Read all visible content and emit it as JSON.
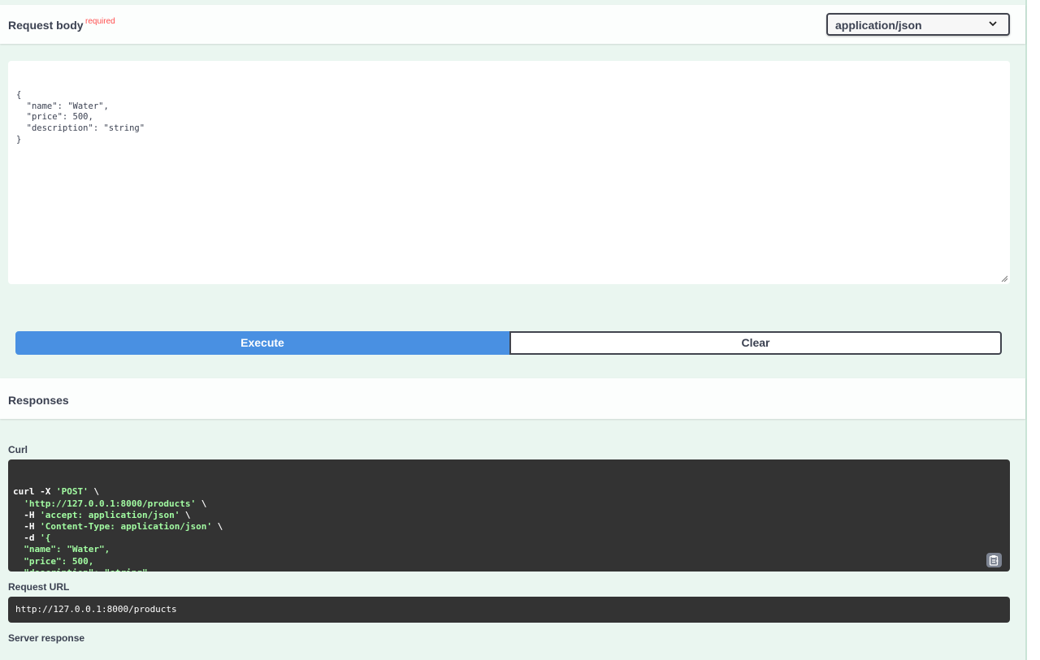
{
  "request_body": {
    "title": "Request body",
    "required_flag": "required",
    "content_type": "application/json",
    "editor_lines": [
      "{",
      "  \"name\": \"Water\",",
      "  \"price\": 500,",
      "  \"description\": \"string\"",
      "}"
    ]
  },
  "actions": {
    "execute_label": "Execute",
    "clear_label": "Clear"
  },
  "responses": {
    "title": "Responses",
    "curl_label": "Curl",
    "curl_lines": [
      [
        {
          "t": "curl -X ",
          "c": "white"
        },
        {
          "t": "'POST'",
          "c": "green"
        },
        {
          "t": " \\",
          "c": "white"
        }
      ],
      [
        {
          "t": "  ",
          "c": "white"
        },
        {
          "t": "'http://127.0.0.1:8000/products'",
          "c": "green"
        },
        {
          "t": " \\",
          "c": "white"
        }
      ],
      [
        {
          "t": "  -H ",
          "c": "white"
        },
        {
          "t": "'accept: application/json'",
          "c": "green"
        },
        {
          "t": " \\",
          "c": "white"
        }
      ],
      [
        {
          "t": "  -H ",
          "c": "white"
        },
        {
          "t": "'Content-Type: application/json'",
          "c": "green"
        },
        {
          "t": " \\",
          "c": "white"
        }
      ],
      [
        {
          "t": "  -d ",
          "c": "white"
        },
        {
          "t": "'{",
          "c": "green"
        }
      ],
      [
        {
          "t": "  \"name\": \"Water\",",
          "c": "green"
        }
      ],
      [
        {
          "t": "  \"price\": 500,",
          "c": "green"
        }
      ],
      [
        {
          "t": "  \"description\": \"string\"",
          "c": "green"
        }
      ],
      [
        {
          "t": "}'",
          "c": "green"
        }
      ]
    ],
    "request_url_label": "Request URL",
    "request_url": "http://127.0.0.1:8000/products",
    "server_response_label": "Server response"
  },
  "icons": {
    "dropdown": "chevron-down-icon",
    "copy": "clipboard-icon",
    "resize": "resize-grip-icon"
  },
  "colors": {
    "execute": "#4990e2",
    "panel_bg": "#eaf6f0",
    "code_bg": "#333333",
    "code_string": "#a2fca2",
    "required": "#ff4f4f"
  }
}
